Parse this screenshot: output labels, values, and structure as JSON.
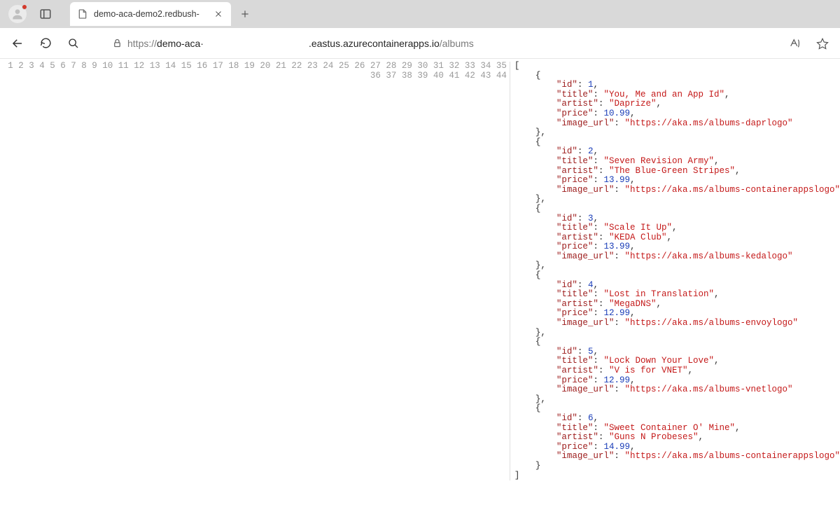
{
  "browser": {
    "tab_title": "demo-aca-demo2.redbush-",
    "url_prefix": "https://",
    "url_host_left": "demo-aca·",
    "url_host_right": ".eastus.azurecontainerapps.io",
    "url_path": "/albums"
  },
  "json_response": {
    "albums": [
      {
        "id": 1,
        "title": "You, Me and an App Id",
        "artist": "Daprize",
        "price": 10.99,
        "image_url": "https://aka.ms/albums-daprlogo"
      },
      {
        "id": 2,
        "title": "Seven Revision Army",
        "artist": "The Blue-Green Stripes",
        "price": 13.99,
        "image_url": "https://aka.ms/albums-containerappslogo"
      },
      {
        "id": 3,
        "title": "Scale It Up",
        "artist": "KEDA Club",
        "price": 13.99,
        "image_url": "https://aka.ms/albums-kedalogo"
      },
      {
        "id": 4,
        "title": "Lost in Translation",
        "artist": "MegaDNS",
        "price": 12.99,
        "image_url": "https://aka.ms/albums-envoylogo"
      },
      {
        "id": 5,
        "title": "Lock Down Your Love",
        "artist": "V is for VNET",
        "price": 12.99,
        "image_url": "https://aka.ms/albums-vnetlogo"
      },
      {
        "id": 6,
        "title": "Sweet Container O' Mine",
        "artist": "Guns N Probeses",
        "price": 14.99,
        "image_url": "https://aka.ms/albums-containerappslogo"
      }
    ],
    "line_count": 44
  }
}
